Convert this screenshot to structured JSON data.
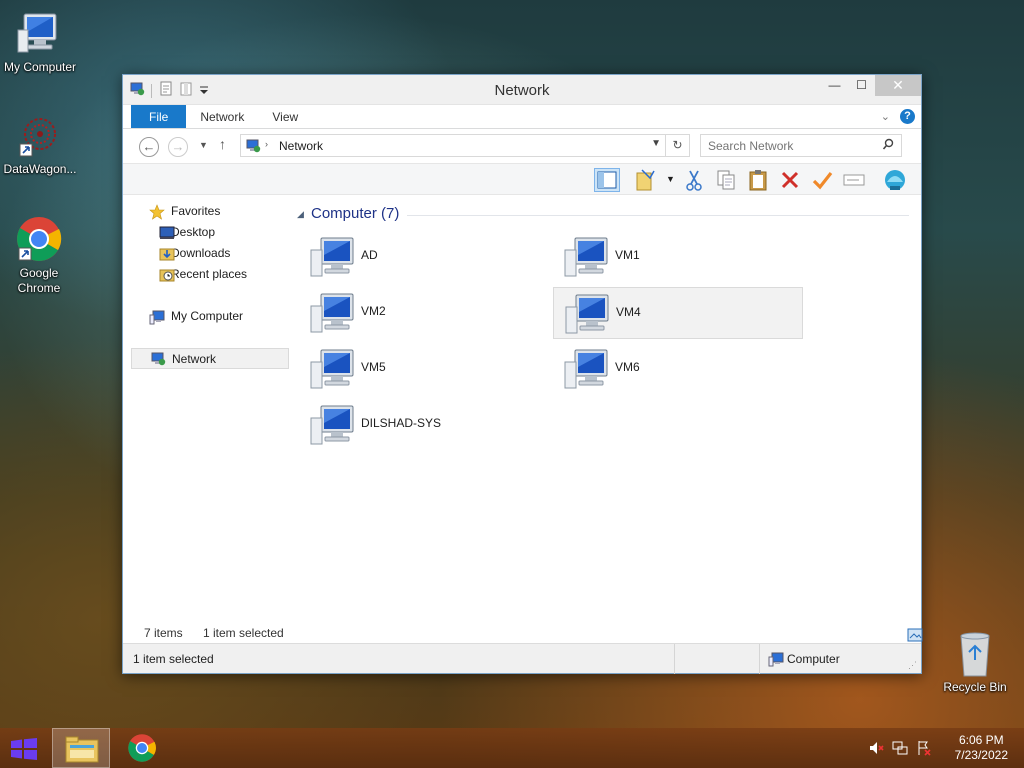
{
  "desktop": {
    "icons": [
      {
        "label": "My Computer"
      },
      {
        "label": "DataWagon..."
      },
      {
        "label": "Google\nChrome"
      },
      {
        "label": "Recycle Bin"
      }
    ]
  },
  "window": {
    "title": "Network",
    "ribbon_tabs": [
      "File",
      "Network",
      "View"
    ],
    "address": {
      "path": "Network"
    },
    "search": {
      "placeholder": "Search Network"
    },
    "nav_pane": {
      "favorites": "Favorites",
      "favorites_items": [
        "Desktop",
        "Downloads",
        "Recent places"
      ],
      "my_computer": "My Computer",
      "network": "Network"
    },
    "content": {
      "group_label": "Computer (7)",
      "items": [
        {
          "name": "AD",
          "selected": false
        },
        {
          "name": "VM1",
          "selected": false
        },
        {
          "name": "VM2",
          "selected": false
        },
        {
          "name": "VM4",
          "selected": true
        },
        {
          "name": "VM5",
          "selected": false
        },
        {
          "name": "VM6",
          "selected": false
        },
        {
          "name": "DILSHAD-SYS",
          "selected": false
        }
      ]
    },
    "status": {
      "item_count": "7 items",
      "selection": "1 item selected",
      "bar_left": "1 item selected",
      "bar_right": "Computer"
    }
  },
  "taskbar": {
    "time": "6:06 PM",
    "date": "7/23/2022"
  },
  "colors": {
    "accent": "#1979ca",
    "group_header": "#1e3287"
  }
}
